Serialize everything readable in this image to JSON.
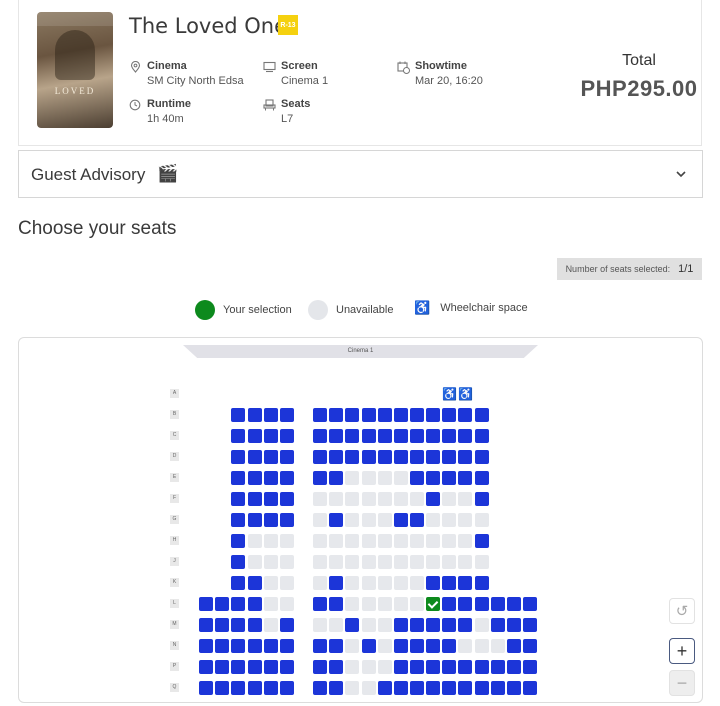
{
  "movie": {
    "title": "The Loved One",
    "rating": "R-13",
    "poster_text": "LOVED"
  },
  "details": {
    "cinema": {
      "label": "Cinema",
      "value": "SM City North Edsa",
      "icon": "location-pin-icon"
    },
    "screen": {
      "label": "Screen",
      "value": "Cinema 1",
      "icon": "monitor-icon"
    },
    "showtime": {
      "label": "Showtime",
      "value": "Mar 20, 16:20",
      "icon": "calendar-clock-icon"
    },
    "runtime": {
      "label": "Runtime",
      "value": "1h 40m",
      "icon": "clock-icon"
    },
    "seats": {
      "label": "Seats",
      "value": "L7",
      "icon": "seat-icon"
    }
  },
  "total": {
    "label": "Total",
    "value": "PHP295.00"
  },
  "advisory": {
    "label": "Guest Advisory",
    "icon": "clapperboard-icon"
  },
  "seat_section": {
    "title": "Choose your seats",
    "selected_label": "Number of seats selected:",
    "selected_value": "1/1",
    "screen_label": "Cinema 1"
  },
  "legend": {
    "selected": "Your selection",
    "unavailable": "Unavailable",
    "wheelchair": "Wheelchair space"
  },
  "colors": {
    "available": "#1c35d8",
    "unavailable": "#e6e8ec",
    "selected": "#0d8a1d",
    "rating_badge": "#f5d10f"
  },
  "seat_rows": [
    {
      "row": "A",
      "left": "------",
      "mid": "-------",
      "right": "-WW----"
    },
    {
      "row": "B",
      "left": "--AAAA",
      "mid": "AAAAAAA",
      "right": "AAAA---"
    },
    {
      "row": "C",
      "left": "--AAAA",
      "mid": "AAAAAAA",
      "right": "AAAA---"
    },
    {
      "row": "D",
      "left": "--AAAA",
      "mid": "AAAAAAA",
      "right": "AAAA---"
    },
    {
      "row": "E",
      "left": "--AAAA",
      "mid": "AAUUUUA",
      "right": "AAAA---"
    },
    {
      "row": "F",
      "left": "--AAAA",
      "mid": "UUUUUUU",
      "right": "AUUA---"
    },
    {
      "row": "G",
      "left": "--AAAA",
      "mid": "UAUUUAA",
      "right": "UUUU---"
    },
    {
      "row": "H",
      "left": "--AUUU",
      "mid": "UUUUUUU",
      "right": "UUUA---"
    },
    {
      "row": "J",
      "left": "--AUUU",
      "mid": "UUUUUUU",
      "right": "UUUU---"
    },
    {
      "row": "K",
      "left": "--AAUU",
      "mid": "UAUUUUU",
      "right": "AAAA---"
    },
    {
      "row": "L",
      "left": "AAAAUU",
      "mid": "AAUUUUU",
      "right": "SAAAAAA"
    },
    {
      "row": "M",
      "left": "AAAAUA",
      "mid": "UUAUUAA",
      "right": "AAAUAAA"
    },
    {
      "row": "N",
      "left": "AAAAAA",
      "mid": "AAUAUAA",
      "right": "AAUUUAA"
    },
    {
      "row": "P",
      "left": "AAAAAA",
      "mid": "AAUUUAA",
      "right": "AAAAAAA"
    },
    {
      "row": "Q",
      "left": "AAAAAA",
      "mid": "AAUUAAA",
      "right": "AAAAAAA"
    }
  ]
}
